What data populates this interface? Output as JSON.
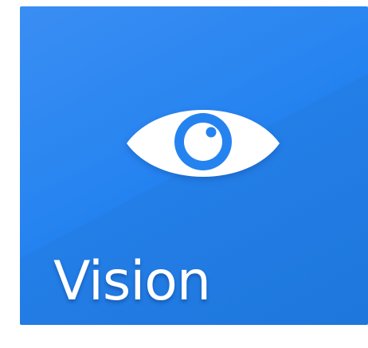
{
  "tile": {
    "label": "Vision",
    "icon": "eye-icon",
    "background_color": "#2583f0",
    "icon_color": "#ffffff"
  }
}
